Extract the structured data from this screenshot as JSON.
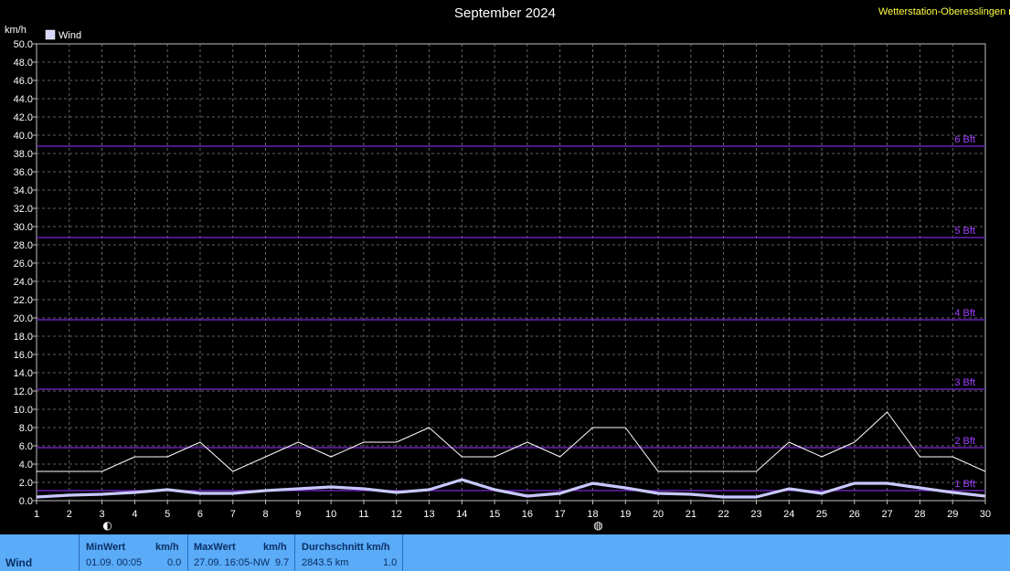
{
  "header": {
    "title": "September 2024",
    "station": "Wetterstation-Oberesslingen n",
    "unit": "km/h"
  },
  "colors": {
    "background": "#000000",
    "grid": "#808080",
    "beaufort_line": "#7b2ad8",
    "beaufort_label": "#a040ff",
    "series_upper": "#c8c8ff",
    "series_lower": "#ffffff",
    "panel": "#5aabf8"
  },
  "chart_data": {
    "type": "line",
    "title": "September 2024",
    "ylabel": "km/h",
    "ylim": [
      0,
      50
    ],
    "xlim": [
      1,
      30
    ],
    "grid": true,
    "legend_position": "top-left",
    "y_ticks": [
      "0.0",
      "2.0",
      "4.0",
      "6.0",
      "8.0",
      "10.0",
      "12.0",
      "14.0",
      "16.0",
      "18.0",
      "20.0",
      "22.0",
      "24.0",
      "26.0",
      "28.0",
      "30.0",
      "32.0",
      "34.0",
      "36.0",
      "38.0",
      "40.0",
      "42.0",
      "44.0",
      "46.0",
      "48.0",
      "50.0"
    ],
    "x_ticks": [
      "1",
      "2",
      "3",
      "4",
      "5",
      "6",
      "7",
      "8",
      "9",
      "10",
      "11",
      "12",
      "13",
      "14",
      "15",
      "16",
      "17",
      "18",
      "19",
      "20",
      "21",
      "22",
      "23",
      "24",
      "25",
      "26",
      "27",
      "28",
      "29",
      "30"
    ],
    "legend": [
      "Wind"
    ],
    "x": [
      1,
      2,
      3,
      4,
      5,
      6,
      7,
      8,
      9,
      10,
      11,
      12,
      13,
      14,
      15,
      16,
      17,
      18,
      19,
      20,
      21,
      22,
      23,
      24,
      25,
      26,
      27,
      28,
      29,
      30
    ],
    "series": [
      {
        "name": "Wind",
        "values": [
          3.2,
          3.2,
          3.2,
          4.8,
          4.8,
          6.4,
          3.2,
          4.8,
          6.4,
          4.8,
          6.4,
          6.4,
          8.0,
          4.8,
          4.8,
          6.4,
          4.8,
          8.0,
          8.0,
          3.2,
          3.2,
          3.2,
          3.2,
          6.4,
          4.8,
          6.4,
          9.7,
          4.8,
          4.8,
          3.2
        ]
      },
      {
        "values": [
          0.4,
          0.6,
          0.7,
          0.9,
          1.2,
          0.8,
          0.8,
          1.1,
          1.3,
          1.5,
          1.3,
          0.9,
          1.2,
          2.3,
          1.2,
          0.5,
          0.8,
          1.9,
          1.4,
          0.8,
          0.7,
          0.4,
          0.4,
          1.3,
          0.8,
          1.9,
          1.9,
          1.4,
          0.9,
          0.5
        ]
      }
    ],
    "beaufort_lines": [
      {
        "label": "1 Bft",
        "value": 1.1
      },
      {
        "label": "2 Bft",
        "value": 5.8
      },
      {
        "label": "3 Bft",
        "value": 12.2
      },
      {
        "label": "4 Bft",
        "value": 19.8
      },
      {
        "label": "5 Bft",
        "value": 28.8
      },
      {
        "label": "6 Bft",
        "value": 38.8
      }
    ],
    "moon_phases": [
      {
        "x": 3,
        "symbol": "◐"
      },
      {
        "x": 18,
        "symbol": "◍"
      }
    ]
  },
  "summary": {
    "row_label": "Wind",
    "min": {
      "header": "MinWert",
      "unit": "km/h",
      "date": "01.09.  00:05",
      "value": "0.0"
    },
    "max": {
      "header": "MaxWert",
      "unit": "km/h",
      "date": "27.09.  16:05-NW",
      "value": "9.7"
    },
    "avg": {
      "header": "Durchschnitt km/h",
      "distance": "2843.5 km",
      "value": "1.0"
    }
  }
}
